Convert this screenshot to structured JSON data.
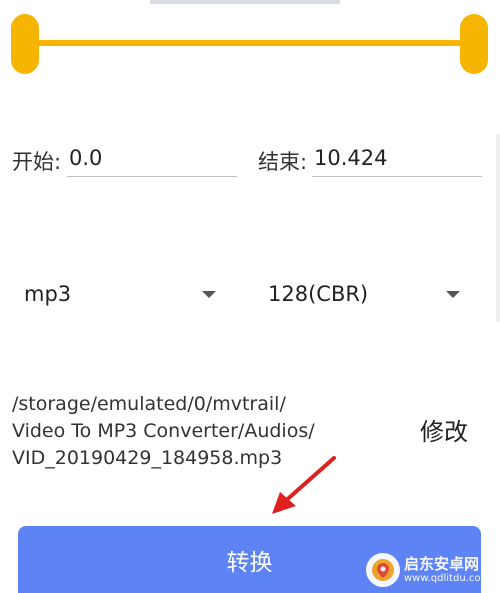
{
  "range": {
    "start_label": "开始:",
    "start_value": "0.0",
    "end_label": "结束:",
    "end_value": "10.424"
  },
  "format": {
    "selected": "mp3"
  },
  "bitrate": {
    "selected": "128(CBR)"
  },
  "output": {
    "path_lines": [
      "/storage/emulated/0/mvtrail/",
      "Video To MP3 Converter/Audios/",
      "VID_20190429_184958.mp3"
    ],
    "modify_label": "修改"
  },
  "actions": {
    "convert_label": "转换"
  },
  "watermark": {
    "name": "启东安卓网",
    "url": "www.qdlitdu.com"
  },
  "colors": {
    "slider": "#f6b502",
    "convert_button": "#5e83f5",
    "annotation_arrow": "#e02020"
  }
}
